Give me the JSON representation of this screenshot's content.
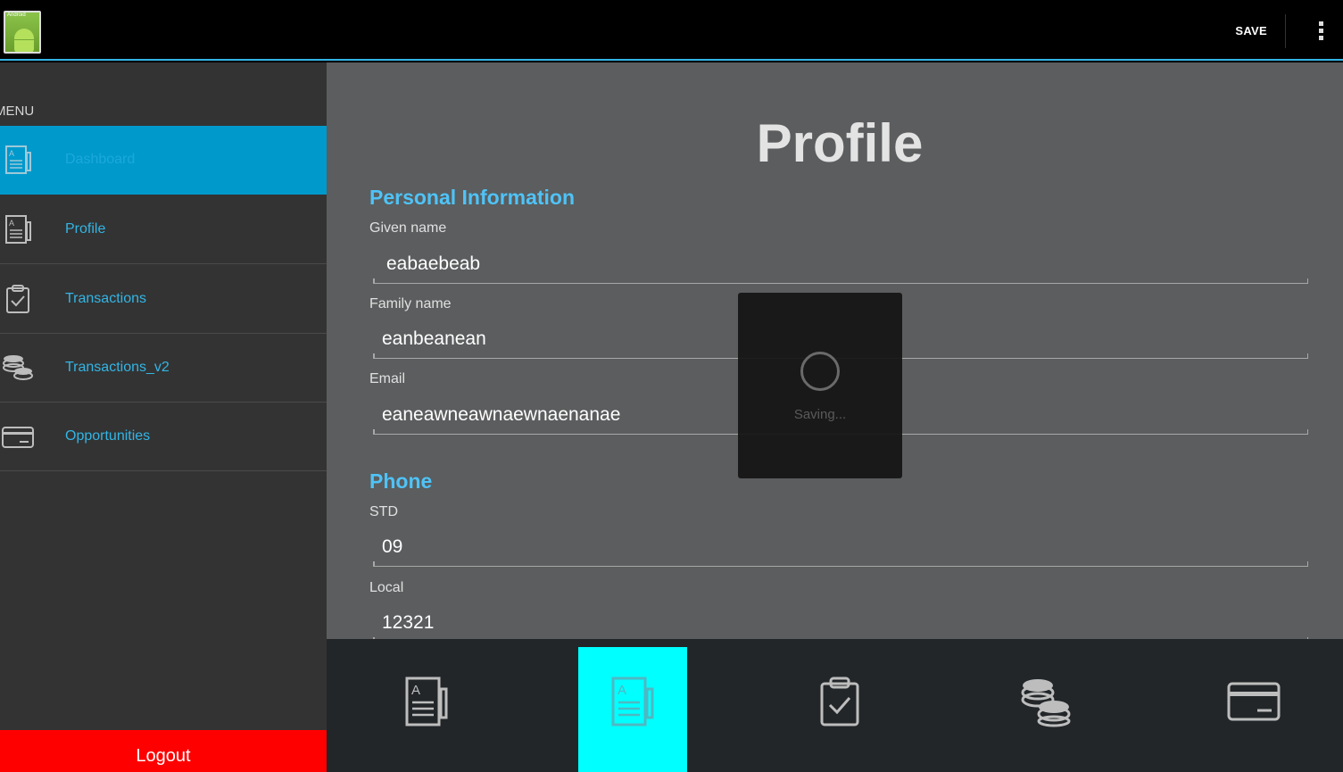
{
  "actionbar": {
    "app_icon_label": "Android",
    "save_label": "SAVE",
    "overflow_icon": "more-vert-icon"
  },
  "sidebar": {
    "header": "MENU",
    "items": [
      {
        "label": "Dashboard",
        "icon": "document-icon",
        "active": true
      },
      {
        "label": "Profile",
        "icon": "document-icon",
        "active": false
      },
      {
        "label": "Transactions",
        "icon": "clipboard-check-icon",
        "active": false
      },
      {
        "label": "Transactions_v2",
        "icon": "coins-icon",
        "active": false
      },
      {
        "label": "Opportunities",
        "icon": "credit-card-icon",
        "active": false
      }
    ],
    "logout_label": "Logout"
  },
  "main": {
    "title": "Profile",
    "personal_section": "Personal Information",
    "given_name_label": "Given name",
    "given_name_value": "eabaebeab",
    "family_name_label": "Family name",
    "family_name_value": "eanbeanean",
    "email_label": "Email",
    "email_value": "eaneawneawnaewnaenanae",
    "phone_section": "Phone",
    "std_label": "STD",
    "std_value": "09",
    "local_label": "Local",
    "local_value": "12321"
  },
  "dialog": {
    "text": "Saving..."
  },
  "tabbar": {
    "tabs": [
      {
        "icon": "document-icon",
        "active": false
      },
      {
        "icon": "document-icon",
        "active": true
      },
      {
        "icon": "clipboard-check-icon",
        "active": false
      },
      {
        "icon": "coins-icon",
        "active": false
      },
      {
        "icon": "credit-card-icon",
        "active": false
      }
    ]
  },
  "colors": {
    "accent": "#33b5e5",
    "active_nav": "#0099cc",
    "logout": "#ff0000",
    "active_tab": "#00ffff"
  }
}
